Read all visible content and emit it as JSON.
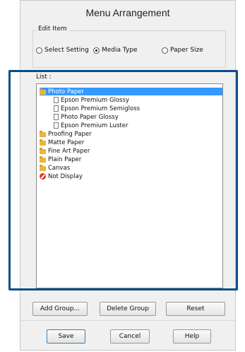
{
  "dialog": {
    "title": "Menu Arrangement"
  },
  "edit_item": {
    "label": "Edit Item",
    "options": [
      {
        "label": "Select Setting",
        "selected": false
      },
      {
        "label": "Media Type",
        "selected": true
      },
      {
        "label": "Paper Size",
        "selected": false
      }
    ]
  },
  "list": {
    "label": "List :",
    "items": [
      {
        "label": "Photo Paper",
        "icon": "folder-icon",
        "selected": true
      },
      {
        "label": "Epson Premium Glossy",
        "icon": "document-icon",
        "selected": false
      },
      {
        "label": "Epson Premium Semigloss",
        "icon": "document-icon",
        "selected": false
      },
      {
        "label": "Photo Paper Glossy",
        "icon": "document-icon",
        "selected": false
      },
      {
        "label": "Epson Premium Luster",
        "icon": "document-icon",
        "selected": false
      },
      {
        "label": "Proofing Paper",
        "icon": "folder-icon",
        "selected": false
      },
      {
        "label": "Matte Paper",
        "icon": "folder-icon",
        "selected": false
      },
      {
        "label": "Fine Art Paper",
        "icon": "folder-icon",
        "selected": false
      },
      {
        "label": "Plain Paper",
        "icon": "folder-icon",
        "selected": false
      },
      {
        "label": "Canvas",
        "icon": "folder-icon",
        "selected": false
      },
      {
        "label": "Not Display",
        "icon": "no-display-icon",
        "selected": false
      }
    ]
  },
  "buttons": {
    "add_group": "Add Group...",
    "delete_group": "Delete Group",
    "reset": "Reset",
    "save": "Save",
    "cancel": "Cancel",
    "help": "Help"
  },
  "colors": {
    "highlight_frame": "#0a4d8c",
    "selection": "#3399ff"
  }
}
